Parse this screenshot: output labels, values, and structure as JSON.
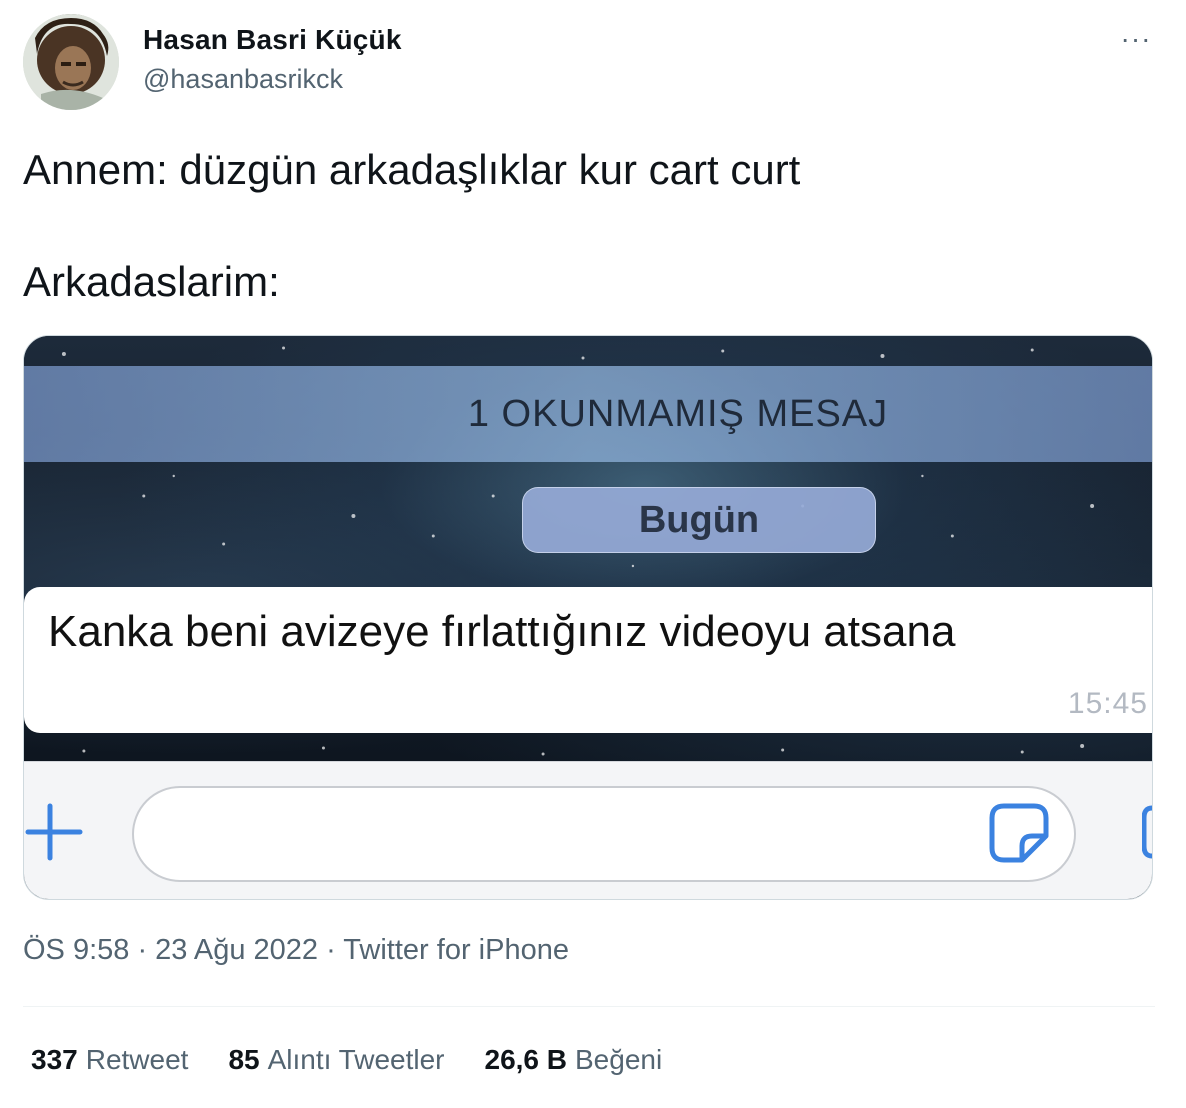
{
  "author": {
    "display_name": "Hasan Basri Küçük",
    "handle": "@hasanbasrikck",
    "avatar_icon": "profile-photo-icon"
  },
  "more_icon": "more-dots-icon",
  "more_label": "···",
  "tweet": {
    "text": "Annem: düzgün arkadaşlıklar kur cart curt\n\nArkadaslarim:"
  },
  "media": {
    "unread_banner": "1 OKUNMAMIŞ MESAJ",
    "date_pill": "Bugün",
    "message_text": "Kanka beni avizeye fırlattığınız videoyu atsana",
    "message_time": "15:45",
    "input_placeholder": "",
    "accent_color": "#3b82e0"
  },
  "meta": {
    "text": "ÖS 9:58 · 23 Ağu 2022 · Twitter for iPhone"
  },
  "stats": {
    "retweets_count": "337",
    "retweets_label": "Retweet",
    "quotes_count": "85",
    "quotes_label": "Alıntı Tweetler",
    "likes_count": "26,6 B",
    "likes_label": "Beğeni"
  }
}
